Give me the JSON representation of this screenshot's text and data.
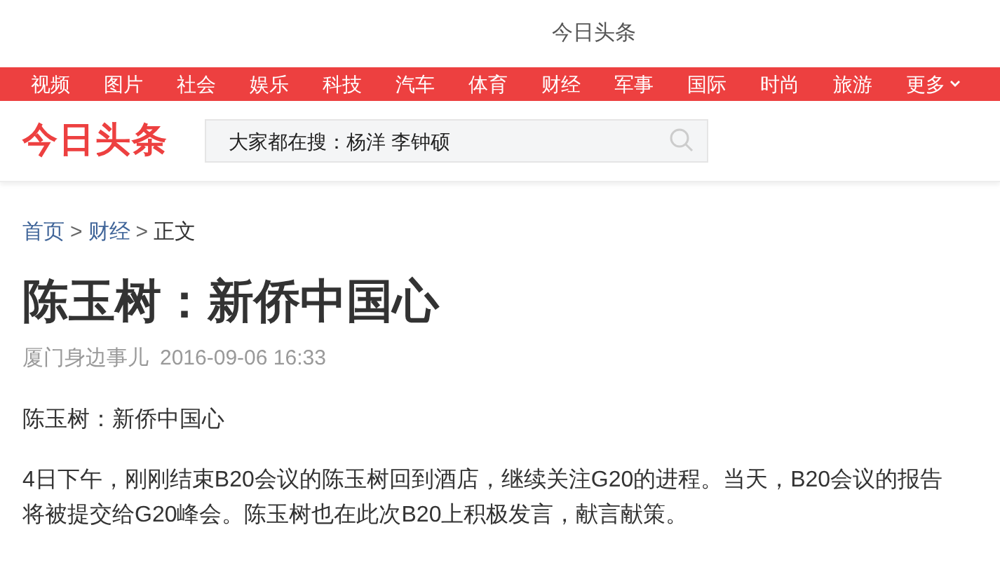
{
  "top_bar": {
    "title": "今日头条"
  },
  "nav": {
    "items": [
      {
        "label": "视频"
      },
      {
        "label": "图片"
      },
      {
        "label": "社会"
      },
      {
        "label": "娱乐"
      },
      {
        "label": "科技"
      },
      {
        "label": "汽车"
      },
      {
        "label": "体育"
      },
      {
        "label": "财经"
      },
      {
        "label": "军事"
      },
      {
        "label": "国际"
      },
      {
        "label": "时尚"
      },
      {
        "label": "旅游"
      }
    ],
    "more": "更多"
  },
  "header": {
    "logo": "今日头条",
    "search": {
      "placeholder": "大家都在搜：杨洋 李钟硕"
    }
  },
  "breadcrumb": [
    {
      "kind": "link",
      "text": "首页"
    },
    {
      "kind": "separator",
      "text": ">"
    },
    {
      "kind": "link",
      "text": "财经"
    },
    {
      "kind": "separator",
      "text": ">"
    },
    {
      "kind": "current",
      "text": "正文"
    }
  ],
  "article": {
    "title": "陈玉树：新侨中国心",
    "source": "厦门身边事儿",
    "time": "2016-09-06 16:33",
    "paragraphs": [
      "陈玉树：新侨中国心",
      "4日下午，刚刚结束B20会议的陈玉树回到酒店，继续关注G20的进程。当天，B20会议的报告将被提交给G20峰会。陈玉树也在此次B20上积极发言，献言献策。"
    ]
  }
}
